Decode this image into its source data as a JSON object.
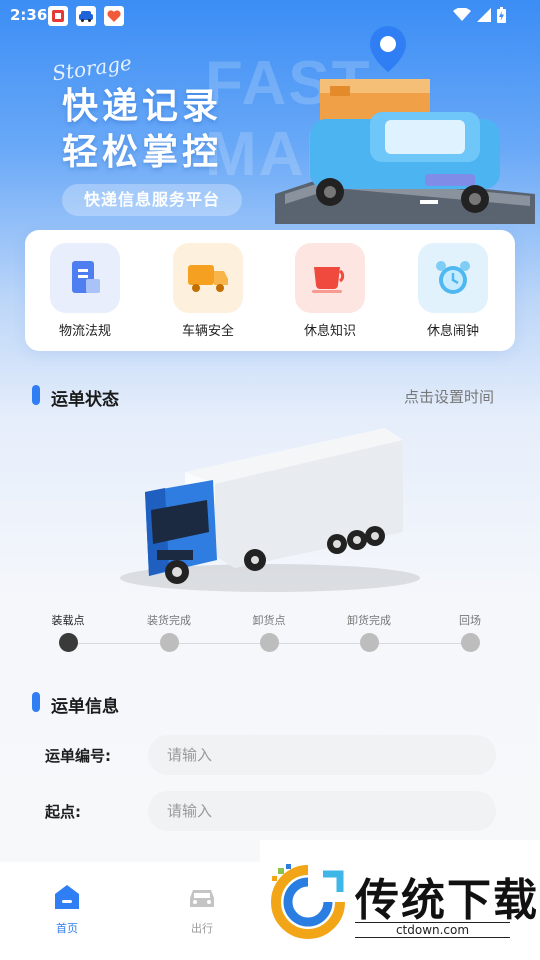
{
  "status_bar": {
    "time": "2:36",
    "notification_icons": [
      "app-notification-icon",
      "car-app-icon",
      "health-app-icon"
    ],
    "system_icons": [
      "wifi-icon",
      "signal-icon",
      "battery-charging-icon"
    ]
  },
  "banner": {
    "background_word": "FAST MAIL",
    "script_word": "Storage",
    "headline_line1": "快递记录",
    "headline_line2": "轻松掌控",
    "tag": "快递信息服务平台"
  },
  "quick_menu": [
    {
      "label": "物流法规",
      "icon": "document-icon",
      "color": "#4f7ef0"
    },
    {
      "label": "车辆安全",
      "icon": "truck-icon",
      "color": "#f5a020"
    },
    {
      "label": "休息知识",
      "icon": "cup-icon",
      "color": "#f04a3e"
    },
    {
      "label": "休息闹钟",
      "icon": "alarm-clock-icon",
      "color": "#4fb8f0"
    }
  ],
  "order_status": {
    "title": "运单状态",
    "link": "点击设置时间",
    "steps": [
      "装载点",
      "装货完成",
      "卸货点",
      "卸货完成",
      "回场"
    ],
    "current_step": 0
  },
  "order_info": {
    "title": "运单信息",
    "fields": [
      {
        "label": "运单编号:",
        "value": "",
        "placeholder": "请输入"
      },
      {
        "label": "起点:",
        "value": "",
        "placeholder": "请输入"
      }
    ]
  },
  "tab_bar": {
    "tabs": [
      {
        "label": "首页",
        "icon": "home-icon",
        "active": true
      },
      {
        "label": "出行",
        "icon": "car-icon",
        "active": false
      }
    ]
  },
  "watermark": {
    "text": "传统下载",
    "url": "ctdown.com"
  },
  "colors": {
    "accent": "#2f7ef3",
    "banner_top": "#3b8df5"
  }
}
